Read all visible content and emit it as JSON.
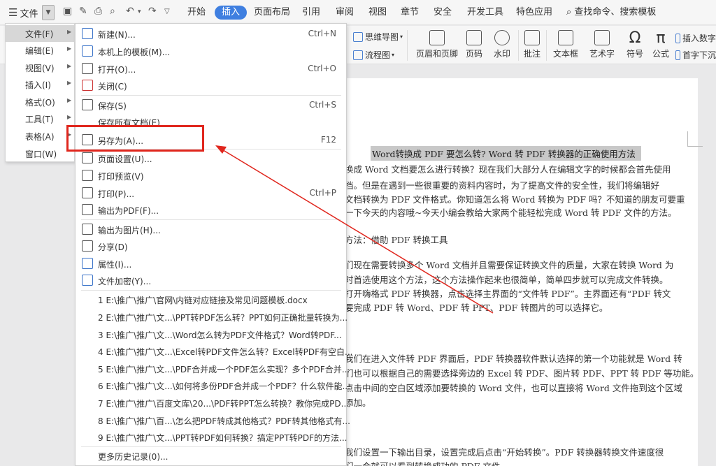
{
  "menubar": {
    "file_label": "文件",
    "tabs": [
      "开始",
      "插入",
      "页面布局",
      "引用",
      "审阅",
      "视图",
      "章节",
      "安全",
      "开发工具",
      "特色应用"
    ],
    "active_tab": "插入",
    "search_label": "查找命令、搜索模板"
  },
  "ribbon": {
    "mindmap": "思维导图",
    "flowchart": "流程图",
    "header_footer": "页眉和页脚",
    "page_number": "页码",
    "watermark": "水印",
    "comment": "批注",
    "textbox": "文本框",
    "wordart": "艺术字",
    "symbol": "符号",
    "formula": "公式",
    "insert_number": "插入数字",
    "drop_cap": "首字下沉"
  },
  "file_menu": {
    "items": [
      "文件(F)",
      "编辑(E)",
      "视图(V)",
      "插入(I)",
      "格式(O)",
      "工具(T)",
      "表格(A)",
      "窗口(W)"
    ]
  },
  "submenu": {
    "items": [
      {
        "label": "新建(N)...",
        "shortcut": "Ctrl+N"
      },
      {
        "label": "本机上的模板(M)...",
        "shortcut": ""
      },
      {
        "label": "打开(O)...",
        "shortcut": "Ctrl+O"
      },
      {
        "label": "关闭(C)",
        "shortcut": ""
      },
      {
        "label": "保存(S)",
        "shortcut": "Ctrl+S"
      },
      {
        "label": "保存所有文档(E)",
        "shortcut": ""
      },
      {
        "label": "另存为(A)...",
        "shortcut": "F12"
      },
      {
        "label": "页面设置(U)...",
        "shortcut": ""
      },
      {
        "label": "打印预览(V)",
        "shortcut": ""
      },
      {
        "label": "打印(P)...",
        "shortcut": "Ctrl+P"
      },
      {
        "label": "输出为PDF(F)...",
        "shortcut": ""
      },
      {
        "label": "输出为图片(H)...",
        "shortcut": ""
      },
      {
        "label": "分享(D)",
        "shortcut": ""
      },
      {
        "label": "属性(I)...",
        "shortcut": ""
      },
      {
        "label": "文件加密(Y)...",
        "shortcut": ""
      }
    ],
    "recent": [
      "1 E:\\推广\\推广\\官网\\内链对应链接及常见问题模板.docx",
      "2 E:\\推广\\推广\\文...\\PPT转PDF怎么转？PPT如何正确批量转换为...",
      "3 E:\\推广\\推广\\文...\\Word怎么转为PDF文件格式？Word转PDF...",
      "4 E:\\推广\\推广\\文...\\Excel转PDF文件怎么转？Excel转PDF有空白...",
      "5 E:\\推广\\推广\\文...\\PDF合并成一个PDF怎么实现？多个PDF合并...",
      "6 E:\\推广\\推广\\文...\\如何将多份PDF合并成一个PDF？什么软件能...",
      "7 E:\\推广\\推广\\百度文库\\20...\\PDF转PPT怎么转换？教你完成PD...",
      "8 E:\\推广\\推广\\百...\\怎么把PDF转成其他格式？PDF转其他格式有...",
      "9 E:\\推广\\推广\\文...\\PPT转PDF如何转换？搞定PPT转PDF的方法..."
    ],
    "more_history": "更多历史记录(0)..."
  },
  "document": {
    "title": "Word转换成 PDF 要怎么转? Word 转 PDF 转换器的正确使用方法",
    "paragraphs": [
      "换成 Word 文档要怎么进行转换？现在我们大部分人在编辑文字的时候都会首先使用",
      "档。但是在遇到一些很重要的资料内容时，为了提高文件的安全性，我们将编辑好",
      "文档转换为 PDF 文件格式。你知道怎么将 Word 转换为 PDF 吗？不知道的朋友可要重",
      "一下今天的内容哦~今天小编会教给大家两个能轻松完成 Word 转 PDF 文件的方法。",
      "方法：借助 PDF 转换工具",
      "们现在需要转换多个 Word 文档并且需要保证转换文件的质量，大家在转换 Word 为",
      "时首选使用这个方法，这个方法操作起来也很简单，简单四步就可以完成文件转换。",
      "打开嗨格式 PDF 转换器，点击选择主界面的“文件转 PDF”。主界面还有“PDF 转文",
      "要完成 PDF 转 Word、PDF 转 PPT、PDF 转图片的可以选择它。",
      "我们在进入文件转 PDF 界面后，PDF 转换器软件默认选择的第一个功能就是 Word 转",
      "们也可以根据自己的需要选择旁边的 Excel 转 PDF、图片转 PDF、PPT 转 PDF 等功能。",
      "点击中间的空白区域添加要转换的 Word 文件，也可以直接将 Word 文件拖到这个区域",
      "添加。",
      "我们设置一下输出目录，设置完成后点击“开始转换”。PDF 转换器转换文件速度很",
      "们一会就可以看到转换成功的 PDF 文件。"
    ]
  },
  "colors": {
    "accent": "#3f7fe0",
    "highlight_box": "#e0261d",
    "selected_menu": "#d7d7d7"
  }
}
